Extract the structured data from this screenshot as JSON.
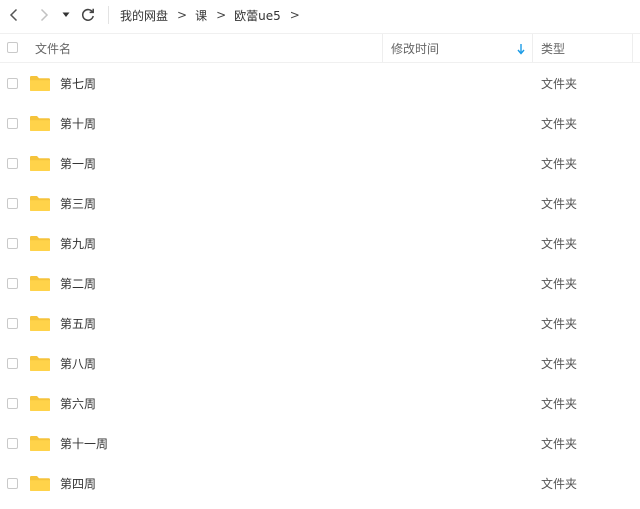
{
  "nav": {
    "back_icon": "chevron-left-icon",
    "forward_icon": "chevron-right-icon",
    "dropdown_icon": "caret-down-icon",
    "refresh_icon": "refresh-icon"
  },
  "breadcrumb": {
    "items": [
      "我的网盘",
      "课",
      "欧蕾ue5"
    ],
    "separator": ">"
  },
  "table": {
    "columns": {
      "name": "文件名",
      "modified": "修改时间",
      "type": "类型"
    },
    "sort": {
      "column": "modified",
      "direction": "descending",
      "color": "#1a9be6"
    },
    "rows": [
      {
        "name": "第七周",
        "type": "文件夹"
      },
      {
        "name": "第十周",
        "type": "文件夹"
      },
      {
        "name": "第一周",
        "type": "文件夹"
      },
      {
        "name": "第三周",
        "type": "文件夹"
      },
      {
        "name": "第九周",
        "type": "文件夹"
      },
      {
        "name": "第二周",
        "type": "文件夹"
      },
      {
        "name": "第五周",
        "type": "文件夹"
      },
      {
        "name": "第八周",
        "type": "文件夹"
      },
      {
        "name": "第六周",
        "type": "文件夹"
      },
      {
        "name": "第十一周",
        "type": "文件夹"
      },
      {
        "name": "第四周",
        "type": "文件夹"
      }
    ]
  },
  "colors": {
    "folder": "#ffd34a",
    "folder_tab": "#f5c33b"
  }
}
